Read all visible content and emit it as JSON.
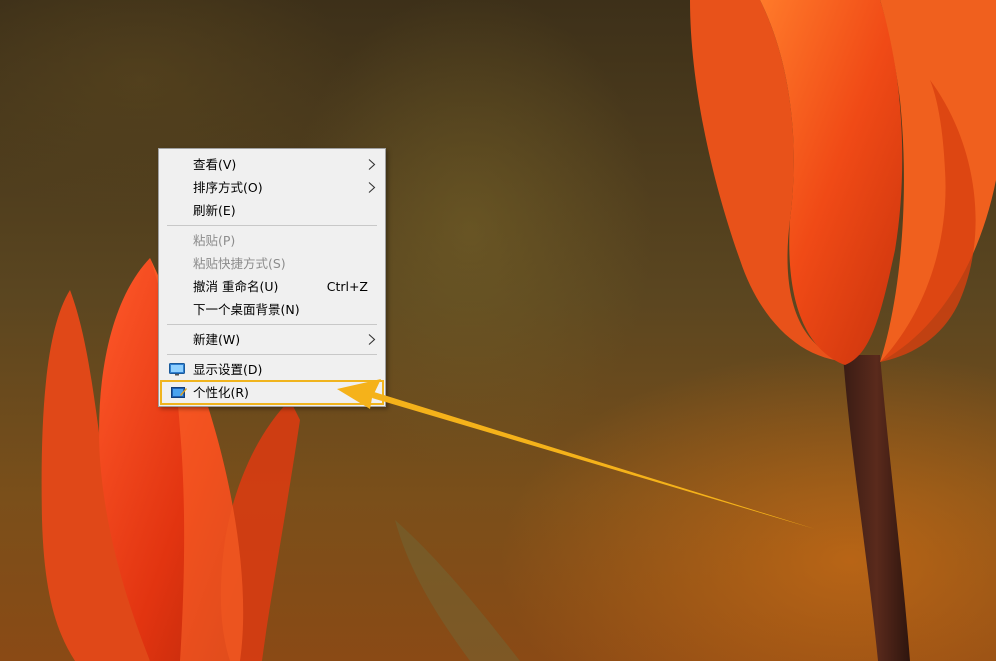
{
  "context_menu": {
    "items": [
      {
        "label": "查看(V)",
        "submenu": true
      },
      {
        "label": "排序方式(O)",
        "submenu": true
      },
      {
        "label": "刷新(E)"
      },
      {
        "label": "粘贴(P)",
        "disabled": true
      },
      {
        "label": "粘贴快捷方式(S)",
        "disabled": true
      },
      {
        "label": "撤消 重命名(U)",
        "shortcut": "Ctrl+Z"
      },
      {
        "label": "下一个桌面背景(N)"
      },
      {
        "label": "新建(W)",
        "submenu": true
      },
      {
        "label": "显示设置(D)",
        "icon": "display-icon"
      },
      {
        "label": "个性化(R)",
        "icon": "personalize-icon",
        "highlighted": true
      }
    ]
  },
  "annotation": {
    "highlight_color": "#f0b41e",
    "arrow_color": "#f5b21a"
  },
  "wallpaper": {
    "subject": "orange-tulips-icon"
  }
}
